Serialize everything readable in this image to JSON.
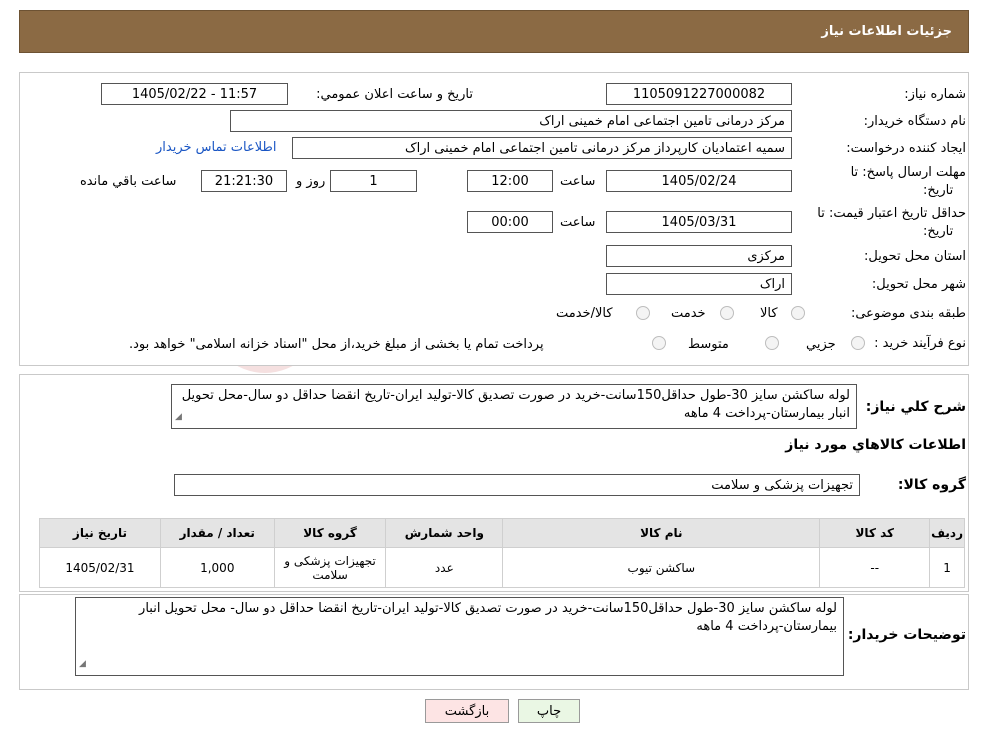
{
  "header": {
    "title": "جزئیات اطلاعات نیاز"
  },
  "watermark": {
    "text": "AriaTender.neT"
  },
  "form": {
    "need_number_label": "شماره نیاز:",
    "need_number": "1105091227000082",
    "announce_label": "تاریخ و ساعت اعلان عمومي:",
    "announce_value": "1405/02/22 - 11:57",
    "buyer_org_label": "نام دستگاه خریدار:",
    "buyer_org": "مرکز درمانی تامین اجتماعی امام خمینی اراک",
    "creator_label": "ایجاد کننده درخواست:",
    "creator": "سمیه اعتمادیان کارپرداز مرکز درمانی تامین اجتماعی امام خمینی اراک",
    "contact_link": "اطلاعات تماس خریدار",
    "deadline_label_1": "مهلت ارسال پاسخ: تا",
    "deadline_label_2": "تاریخ:",
    "deadline_date": "1405/02/24",
    "time_label": "ساعت",
    "deadline_time": "12:00",
    "days_value": "1",
    "days_label": "روز و",
    "remaining_time": "21:21:30",
    "remaining_label": "ساعت باقي مانده",
    "validity_label_1": "حداقل تاریخ اعتبار قیمت: تا",
    "validity_label_2": "تاریخ:",
    "validity_date": "1405/03/31",
    "validity_time_label": "ساعت",
    "validity_time": "00:00",
    "province_label": "استان محل تحویل:",
    "province": "مرکزی",
    "city_label": "شهر محل تحویل:",
    "city": "اراک",
    "category_label": "طبقه بندی موضوعی:",
    "category_options": [
      "کالا",
      "خدمت",
      "کالا/خدمت"
    ],
    "process_label": "نوع فرآیند خرید :",
    "process_options": [
      "جزیي",
      "متوسط"
    ],
    "process_note": "پرداخت تمام یا بخشی از مبلغ خرید،از محل \"اسناد خزانه اسلامی\" خواهد بود."
  },
  "summary": {
    "label": "شرح کلي نیاز:",
    "text": "لوله ساکشن سایز 30-طول حداقل150سانت-خرید در صورت تصدیق کالا-تولید ایران-تاریخ انقضا حداقل دو سال-محل تحویل انبار بیمارستان-پرداخت 4 ماهه",
    "goods_info_title": "اطلاعات کالاهاي مورد نیاز",
    "group_label": "گروه کالا:",
    "group_value": "تجهیزات پزشکی و سلامت"
  },
  "table": {
    "headers": [
      "ردیف",
      "کد کالا",
      "نام کالا",
      "واحد شمارش",
      "گروه کالا",
      "تعداد / مقدار",
      "تاریخ نیاز"
    ],
    "rows": [
      [
        "1",
        "--",
        "ساکشن تیوب",
        "عدد",
        "تجهیزات پزشکی و سلامت",
        "1,000",
        "1405/02/31"
      ]
    ]
  },
  "buyer_notes": {
    "label": "توضیحات خریدار:",
    "text": "لوله ساکشن سایز 30-طول حداقل150سانت-خرید در صورت تصدیق کالا-تولید ایران-تاریخ انقضا حداقل دو سال- محل تحویل انبار بیمارستان-پرداخت 4 ماهه"
  },
  "buttons": {
    "print": "چاپ",
    "back": "بازگشت"
  },
  "colors": {
    "header_bg": "#8b6a44",
    "link": "#1a56c4",
    "print_bg": "#eaf7e4",
    "back_bg": "#fde4e4"
  }
}
